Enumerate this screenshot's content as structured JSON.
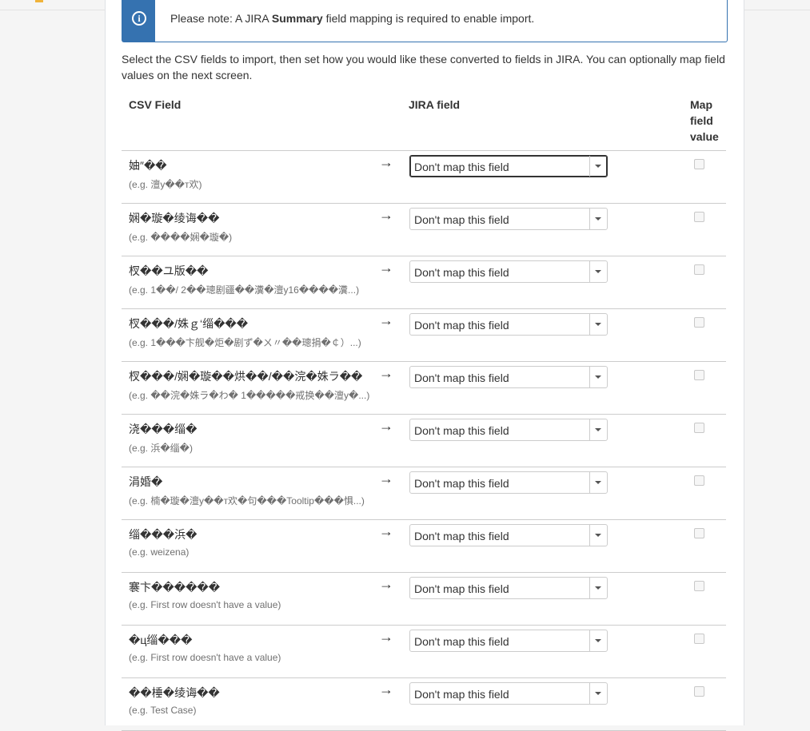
{
  "notice": {
    "prefix": "Please note: A JIRA ",
    "bold": "Summary",
    "suffix": " field mapping is required to enable import."
  },
  "intro": "Select the CSV fields to import, then set how you would like these converted to fields in JIRA. You can optionally map field values on the next screen.",
  "table": {
    "headers": {
      "csv": "CSV Field",
      "jira": "JIRA field",
      "map": "Map field value"
    },
    "arrow": "→",
    "rows": [
      {
        "field": "妯″��",
        "example": "(e.g. 澶у��т欢)",
        "select": "Don't map this field"
      },
      {
        "field": "娴�璇�绫诲��",
        "example": "(e.g. ����娴�璇�)",
        "select": "Don't map this field"
      },
      {
        "field": "杈��ユ版��",
        "example": "(e.g. 1��/ 2��璁剧疆��瀵�澶у16����瀵...)",
        "select": "Don't map this field"
      },
      {
        "field": "杈���/姝ｇ‘缁���",
        "example": "(e.g. 1���卞舰�炬�剧ず�ㄨ〃��璁捐�￠）...)",
        "select": "Don't map this field"
      },
      {
        "field": "杈���/娴�璇��烘��/��浣�姝ラ��",
        "example": "(e.g. ��浣�姝ラ�わ� 1�����戒换��澶у�...)",
        "select": "Don't map this field"
      },
      {
        "field": "浇���缁�",
        "example": "(e.g. 浜�缁�)",
        "select": "Don't map this field"
      },
      {
        "field": "涓婚�",
        "example": "(e.g. 楠�璇�澶у��т欢�句���Tooltip���惧...)",
        "select": "Don't map this field"
      },
      {
        "field": "缁���浜�",
        "example": "(e.g. weizena)",
        "select": "Don't map this field"
      },
      {
        "field": "褰卞������",
        "example": "(e.g. First row doesn't have a value)",
        "select": "Don't map this field"
      },
      {
        "field": "�ц缁���",
        "example": "(e.g. First row doesn't have a value)",
        "select": "Don't map this field"
      },
      {
        "field": "��棰�绫诲��",
        "example": "(e.g. Test Case)",
        "select": "Don't map this field"
      }
    ]
  }
}
